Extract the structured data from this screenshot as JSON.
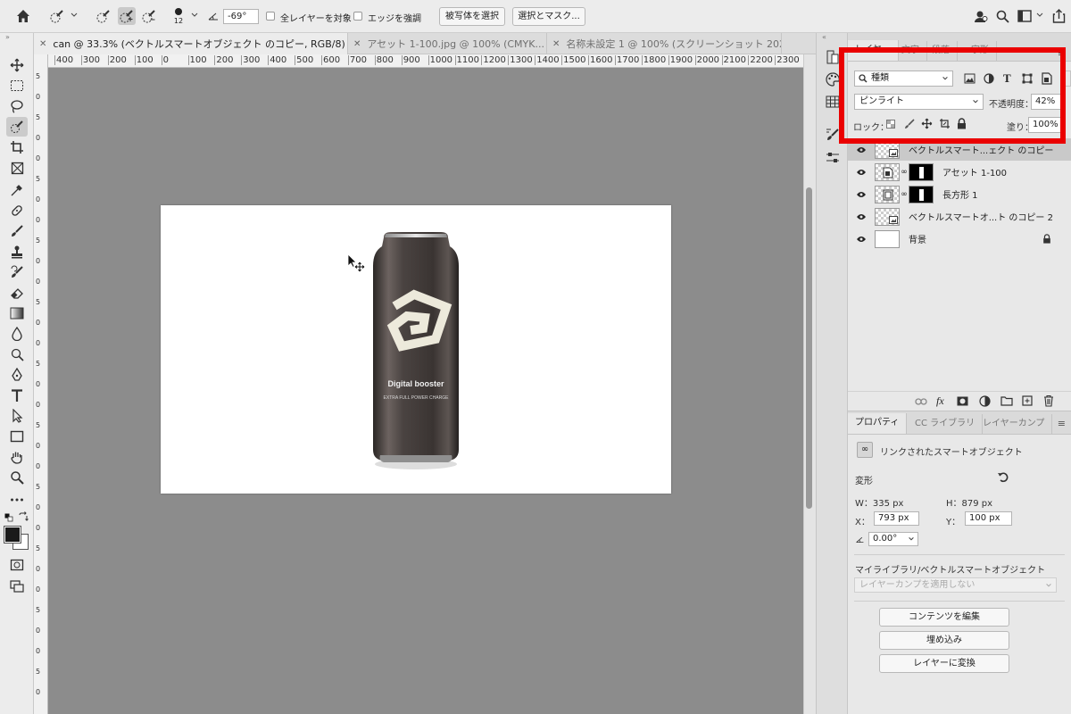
{
  "options_bar": {
    "brush_size": "12",
    "angle_value": "-69°",
    "sample_all_layers_label": "全レイヤーを対象",
    "enhance_edge_label": "エッジを強調",
    "select_subject_label": "被写体を選択",
    "select_and_mask_label": "選択とマスク..."
  },
  "tabs": [
    {
      "label": "can @ 33.3% (ベクトルスマートオブジェクト のコピー, RGB/8) *"
    },
    {
      "label": "アセット 1-100.jpg @ 100% (CMYK..."
    },
    {
      "label": "名称未設定 1 @ 100% (スクリーンショット 202..."
    }
  ],
  "ruler_labels": [
    "400",
    "300",
    "200",
    "100",
    "0",
    "100",
    "200",
    "300",
    "400",
    "500",
    "600",
    "700",
    "800",
    "900",
    "1000",
    "1100",
    "1200",
    "1300",
    "1400",
    "1500",
    "1600",
    "1700",
    "1800",
    "1900",
    "2000",
    "2100",
    "2200",
    "2300"
  ],
  "vruler_labels": [
    "5",
    "0",
    "5",
    "0",
    "0",
    "5",
    "0",
    "0",
    "5",
    "0",
    "0",
    "5",
    "0",
    "0",
    "5",
    "0",
    "0",
    "5",
    "0",
    "0",
    "5",
    "0",
    "0",
    "5",
    "0",
    "0",
    "5",
    "0",
    "0",
    "5",
    "0"
  ],
  "can": {
    "brand": "Digital booster",
    "tagline": "EXTRA FULL POWER CHARGE"
  },
  "layers_panel": {
    "tabs": [
      "レイヤー",
      "文字",
      "段落",
      "字形"
    ],
    "filter_label": "種類",
    "blend_mode": "ピンライト",
    "opacity_label": "不透明度：",
    "opacity_value": "42%",
    "lock_label": "ロック：",
    "fill_label": "塗り：",
    "fill_value": "100%",
    "layers": [
      {
        "name": "ベクトルスマート...ェクト のコピー",
        "selected": true
      },
      {
        "name": "アセット 1-100",
        "selected": false
      },
      {
        "name": "長方形 1",
        "selected": false
      },
      {
        "name": "ベクトルスマートオ...ト のコピー 2",
        "selected": false
      },
      {
        "name": "背景",
        "selected": false
      }
    ]
  },
  "properties_panel": {
    "tabs": [
      "プロパティ",
      "CC ライブラリ",
      "レイヤーカンプ"
    ],
    "object_type": "リンクされたスマートオブジェクト",
    "transform_label": "変形",
    "w_label": "W：335 px",
    "h_label": "H：879 px",
    "x_label": "X：",
    "x_value": "793 px",
    "y_label": "Y：",
    "y_value": "100 px",
    "angle_value": "0.00°",
    "library_label": "マイライブラリ/ベクトルスマートオブジェクト",
    "layer_comp_placeholder": "レイヤーカンプを適用しない",
    "buttons": [
      "コンテンツを編集",
      "埋め込み",
      "レイヤーに変換"
    ]
  },
  "colors": {
    "highlight": "#ea0000",
    "canvas_bg": "#8c8c8c",
    "panel_bg": "#e8e8e8",
    "selected_layer": "#c9c9c9"
  }
}
